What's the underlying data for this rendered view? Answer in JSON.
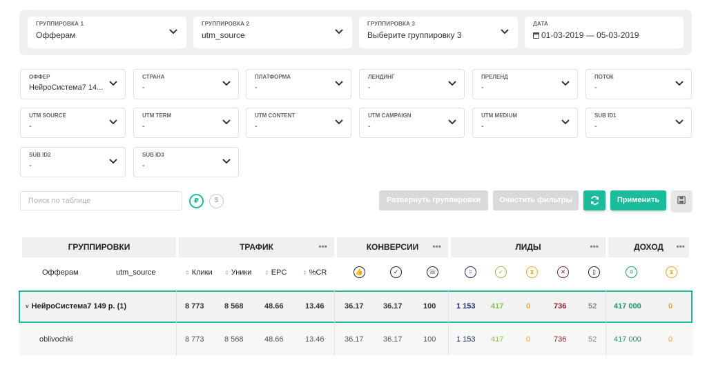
{
  "groupings": [
    {
      "label": "ГРУППИРОВКА 1",
      "value": "Офферам"
    },
    {
      "label": "ГРУППИРОВКА 2",
      "value": "utm_source"
    },
    {
      "label": "ГРУППИРОВКА 3",
      "value": "Выберите группировку 3"
    },
    {
      "label": "ДАТА",
      "value": "01-03-2019 — 05-03-2019"
    }
  ],
  "filters": [
    {
      "label": "ОФФЕР",
      "value": "НейроСистема7 14..."
    },
    {
      "label": "СТРАНА",
      "value": "-"
    },
    {
      "label": "ПЛАТФОРМА",
      "value": "-"
    },
    {
      "label": "ЛЕНДИНГ",
      "value": "-"
    },
    {
      "label": "ПРЕЛЕНД",
      "value": "-"
    },
    {
      "label": "ПОТОК",
      "value": "-"
    },
    {
      "label": "UTM SOURCE",
      "value": "-"
    },
    {
      "label": "UTM TERM",
      "value": "-"
    },
    {
      "label": "UTM CONTENT",
      "value": "-"
    },
    {
      "label": "UTM CAMPAIGN",
      "value": "-"
    },
    {
      "label": "UTM MEDIUM",
      "value": "-"
    },
    {
      "label": "SUB ID1",
      "value": "-"
    },
    {
      "label": "SUB ID2",
      "value": "-"
    },
    {
      "label": "SUB ID3",
      "value": "-"
    }
  ],
  "toolbar": {
    "search_placeholder": "Поиск по таблице",
    "currency_rub": "₽",
    "currency_usd": "$",
    "expand_label": "Развернуть группировки",
    "clear_label": "Очистить фильтры",
    "apply_label": "Применить",
    "accent_color": "#1abc9c"
  },
  "table": {
    "sections": [
      {
        "label": "ГРУППИРОВКИ",
        "menu": ""
      },
      {
        "label": "ТРАФИК",
        "menu": "•••"
      },
      {
        "label": "КОНВЕРСИИ",
        "menu": "•••"
      },
      {
        "label": "ЛИДЫ",
        "menu": "•••"
      },
      {
        "label": "ДОХОД",
        "menu": "•••"
      }
    ],
    "group_columns": [
      "Офферам",
      "utm_source"
    ],
    "traffic_columns": [
      "Клики",
      "Уники",
      "EPC",
      "%CR"
    ],
    "icon_columns": [
      "thumbs-up-icon",
      "check-icon",
      "phone-icon",
      "equals-icon",
      "approved-icon",
      "hold-icon",
      "rejected-icon",
      "trash-icon",
      "money-icon",
      "hold-money-icon"
    ],
    "total_row": {
      "name": "НейроСистема7 149 р. (1)",
      "clicks": "8 773",
      "uniques": "8 568",
      "epc": "48.66",
      "cr": "13.46",
      "conv1": "36.17",
      "conv2": "36.17",
      "conv3": "100",
      "leads_total": "1 153",
      "leads_approved": "417",
      "leads_hold": "0",
      "leads_rejected": "736",
      "leads_trash": "52",
      "income": "417 000",
      "income_hold": "0"
    },
    "rows": [
      {
        "name": "oblivochki",
        "clicks": "8 773",
        "uniques": "8 568",
        "epc": "48.66",
        "cr": "13.46",
        "conv1": "36.17",
        "conv2": "36.17",
        "conv3": "100",
        "leads_total": "1 153",
        "leads_approved": "417",
        "leads_hold": "0",
        "leads_rejected": "736",
        "leads_trash": "52",
        "income": "417 000",
        "income_hold": "0"
      }
    ],
    "colors": {
      "total": "#1e2a6e",
      "approved": "#8bc34a",
      "hold": "#f0a830",
      "rejected": "#8b1e2a",
      "trash": "#888888",
      "income": "#1a9a6a"
    }
  }
}
